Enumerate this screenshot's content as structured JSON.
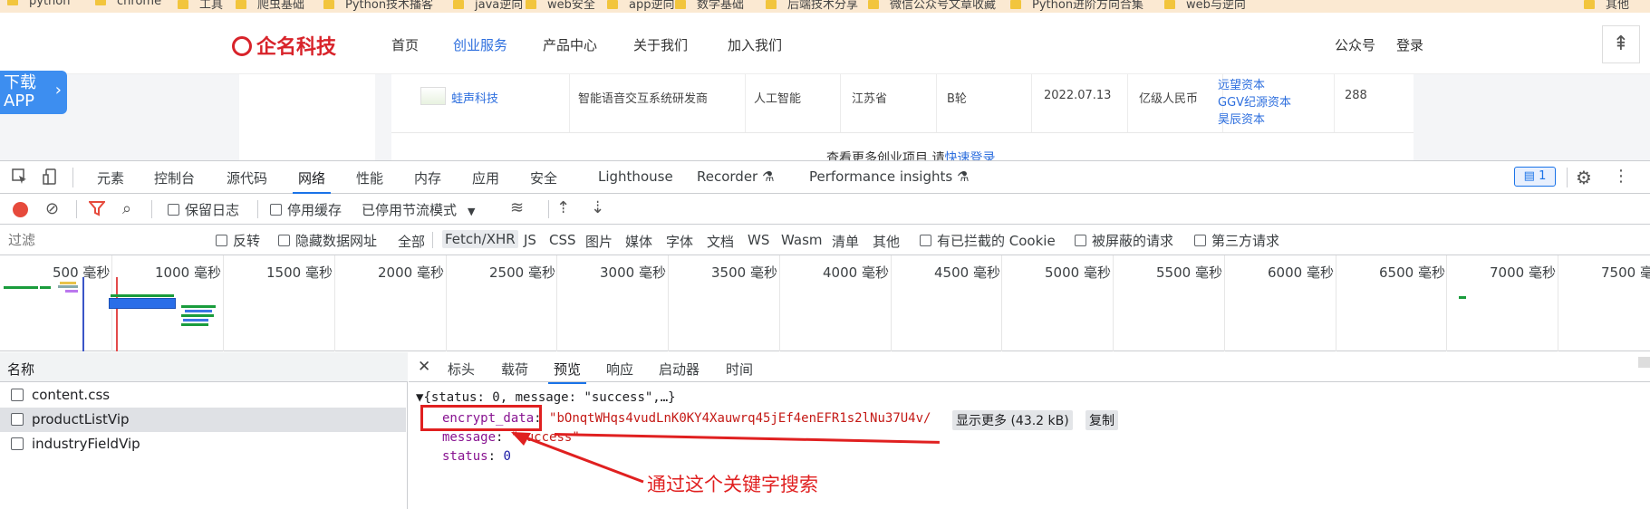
{
  "bookmarks": [
    "python",
    "chrome",
    "工具",
    "爬虫基础",
    "Python技术播客",
    "java逆向",
    "web安全",
    "app逆向",
    "数学基础",
    "后端技术分享",
    "微信公众号文章收藏",
    "Python进阶方向合集",
    "web与逆向",
    "其他"
  ],
  "site": {
    "logo_text": "企名科技",
    "nav": [
      "首页",
      "创业服务",
      "产品中心",
      "关于我们",
      "加入我们"
    ],
    "nav_active": "创业服务",
    "header_right": [
      "公众号",
      "登录"
    ],
    "back_top_icon": "back-to-top-icon",
    "app_badge": {
      "line1": "下载",
      "line2": "APP",
      "arrow": "›"
    },
    "row": {
      "company": "蛙声科技",
      "description": "智能语音交互系统研发商",
      "industry": "人工智能",
      "province": "江苏省",
      "round": "B轮",
      "date": "2022.07.13",
      "amount": "亿级人民币",
      "investors": [
        "远望资本",
        "GGV纪源资本",
        "昊辰资本"
      ],
      "count": "288"
    },
    "more_text": "查看更多创业项目 请",
    "more_link": "快速登录"
  },
  "devtools": {
    "tabs": [
      "元素",
      "控制台",
      "源代码",
      "网络",
      "性能",
      "内存",
      "应用",
      "安全",
      "Lighthouse",
      "Recorder ⚗",
      "Performance insights ⚗"
    ],
    "active_tab": "网络",
    "message_count": "1",
    "toolbar": {
      "preserve_log": "保留日志",
      "disable_cache": "停用缓存",
      "throttle": "已停用节流模式",
      "throttle_arrow": "▼"
    },
    "filter": {
      "placeholder": "过滤",
      "invert": "反转",
      "hide_data_urls": "隐藏数据网址",
      "types": [
        "全部",
        "Fetch/XHR",
        "JS",
        "CSS",
        "图片",
        "媒体",
        "字体",
        "文档",
        "WS",
        "Wasm",
        "清单",
        "其他"
      ],
      "selected_type": "Fetch/XHR",
      "blocked_cookies": "有已拦截的 Cookie",
      "blocked_requests": "被屏蔽的请求",
      "third_party": "第三方请求"
    },
    "timeline_ticks": [
      "500 毫秒",
      "1000 毫秒",
      "1500 毫秒",
      "2000 毫秒",
      "2500 毫秒",
      "3000 毫秒",
      "3500 毫秒",
      "4000 毫秒",
      "4500 毫秒",
      "5000 毫秒",
      "5500 毫秒",
      "6000 毫秒",
      "6500 毫秒",
      "7000 毫秒",
      "7500 毫秒"
    ],
    "names_header": "名称",
    "requests": [
      "content.css",
      "productListVip",
      "industryFieldVip"
    ],
    "selected_request": "productListVip",
    "detail_tabs": [
      "标头",
      "载荷",
      "预览",
      "响应",
      "启动器",
      "时间"
    ],
    "active_detail_tab": "预览",
    "preview": {
      "summary": "{status: 0, message: \"success\",…}",
      "encrypt_key": "encrypt_data",
      "encrypt_value": "\"bOnqtWHqs4vudLnK0KY4Xauwrq45jEf4enEFR1s2lNu37U4v/",
      "show_more": "显示更多 (43.2 kB)",
      "copy": "复制",
      "message_key": "message",
      "message_value": "\"success\"",
      "status_key": "status",
      "status_value": "0"
    }
  },
  "annotation": {
    "text": "通过这个关键字搜索",
    "color": "#e02020"
  }
}
